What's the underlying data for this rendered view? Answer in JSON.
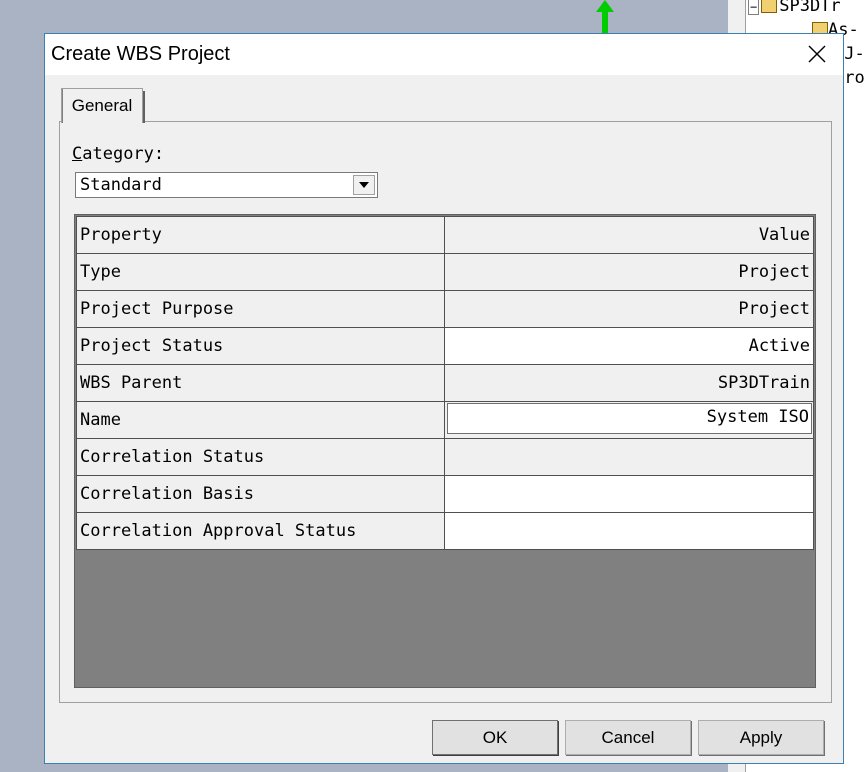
{
  "background_app": {
    "tree_items": [
      "SP3DTr",
      "As-",
      "PJ-",
      "Pro"
    ]
  },
  "dialog": {
    "title": "Create WBS Project",
    "close_icon": "close-icon",
    "tabs": [
      {
        "label": "General",
        "selected": true
      }
    ],
    "category": {
      "label": "Category:",
      "selected": "Standard",
      "arrow_icon": "dropdown-arrow-icon"
    },
    "grid": {
      "header": {
        "property": "Property",
        "value": "Value"
      },
      "rows": [
        {
          "property": "Type",
          "value": "Project"
        },
        {
          "property": "Project Purpose",
          "value": "Project"
        },
        {
          "property": "Project Status",
          "value": "Active"
        },
        {
          "property": "WBS Parent",
          "value": "SP3DTrain"
        },
        {
          "property": "Name",
          "value": "System ISO"
        },
        {
          "property": "Correlation Status",
          "value": ""
        },
        {
          "property": "Correlation Basis",
          "value": ""
        },
        {
          "property": "Correlation Approval Status",
          "value": ""
        }
      ]
    },
    "buttons": {
      "ok": "OK",
      "cancel": "Cancel",
      "apply": "Apply"
    }
  },
  "colors": {
    "desktop": "#a9b3c3",
    "dialog_border": "#3c7fb1",
    "grid_empty_area": "#808080",
    "arrow_green": "#00cc00"
  }
}
